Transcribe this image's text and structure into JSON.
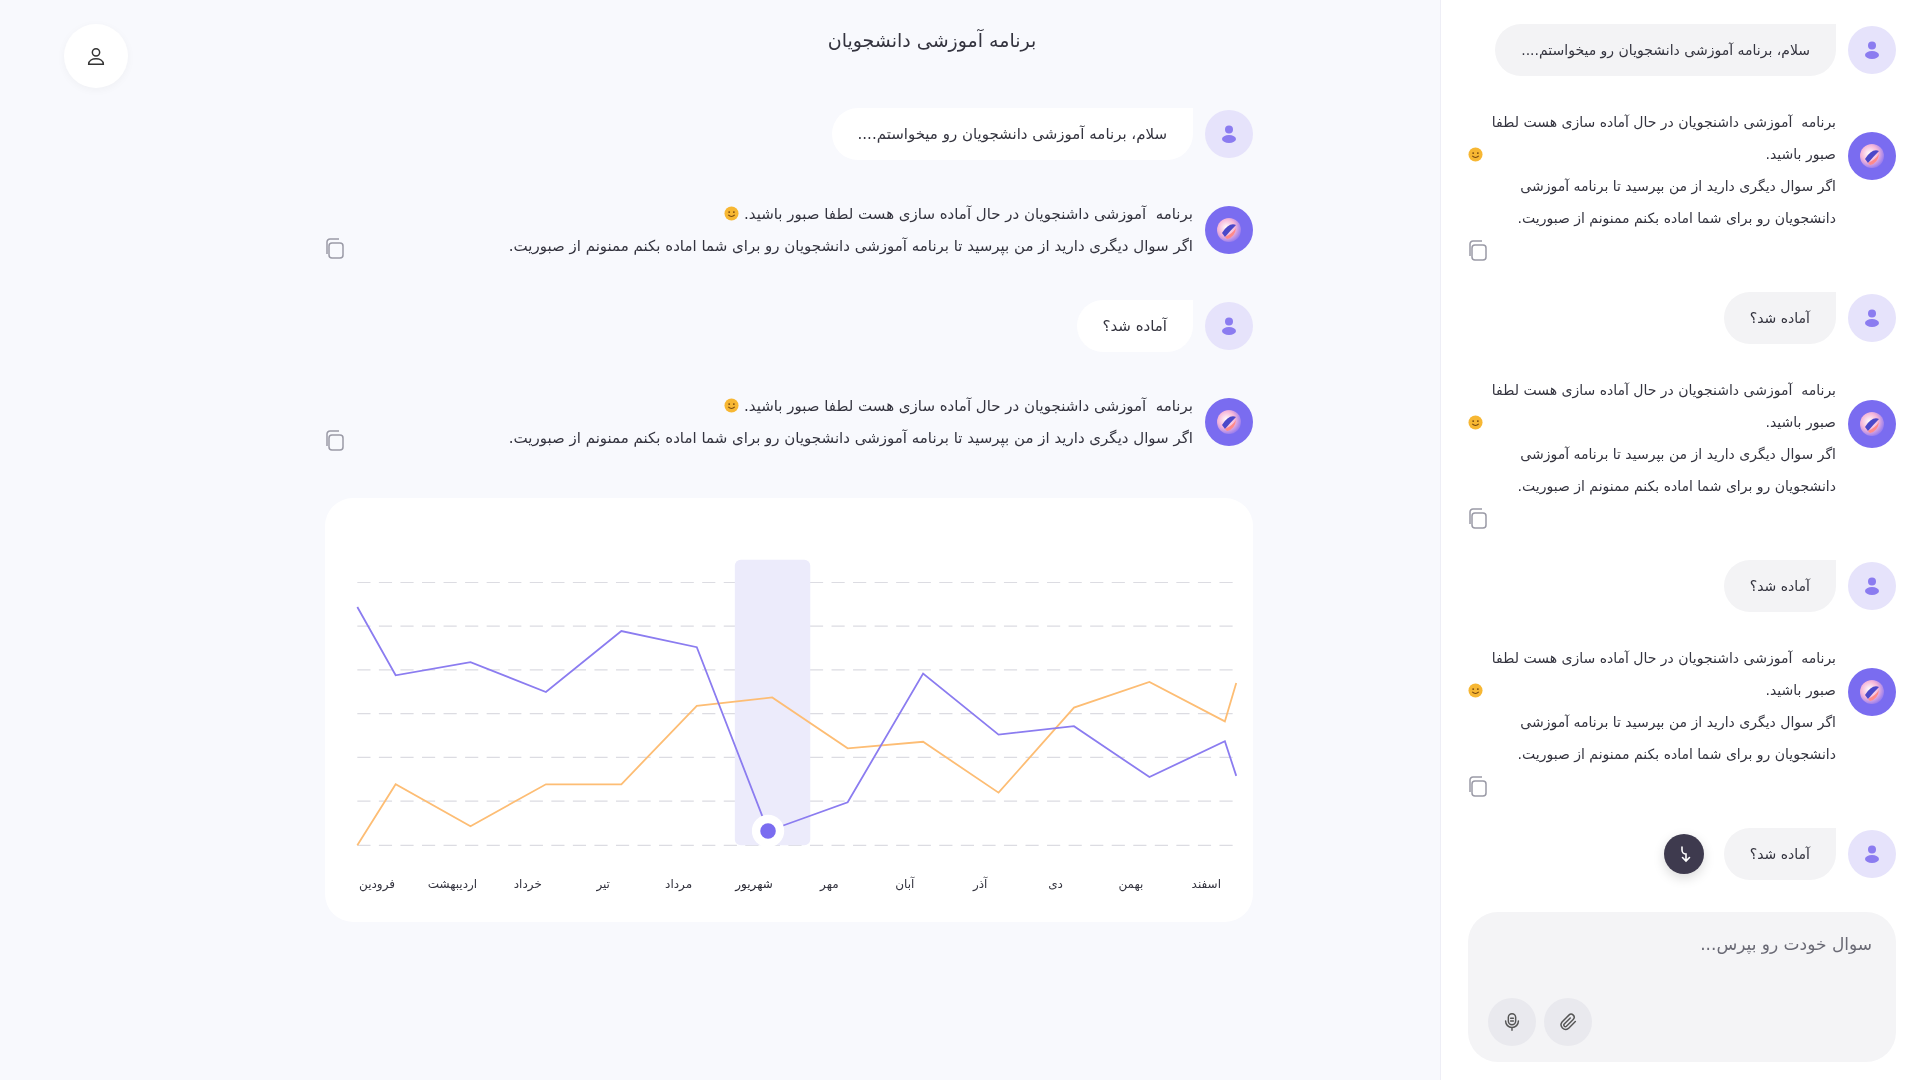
{
  "header": {
    "title": "برنامه آموزشی دانشجویان"
  },
  "main_chat": {
    "messages": [
      {
        "kind": "user",
        "text": "سلام، برنامه آموزشی دانشجویان رو میخواستم...."
      },
      {
        "kind": "bot",
        "lines": [
          "برنامه  آموزشی داشنجویان در حال آماده سازی هست لطفا صبور باشید.",
          "اگر سوال دیگری دارید از من بپرسید تا برنامه آموزشی دانشجویان رو برای شما اماده بکنم ممنونم از صبوریت."
        ]
      },
      {
        "kind": "user",
        "text": "آماده شد؟"
      },
      {
        "kind": "bot",
        "lines": [
          "برنامه  آموزشی داشنجویان در حال آماده سازی هست لطفا صبور باشید.",
          "اگر سوال دیگری دارید از من بپرسید تا برنامه آموزشی دانشجویان رو برای شما اماده بکنم ممنونم از صبوریت."
        ]
      }
    ]
  },
  "chart": {
    "months": [
      {
        "label": "اسفند",
        "selected": false
      },
      {
        "label": "بهمن",
        "selected": false
      },
      {
        "label": "دی",
        "selected": false
      },
      {
        "label": "آذر",
        "selected": false
      },
      {
        "label": "آبان",
        "selected": false
      },
      {
        "label": "مهر",
        "selected": false
      },
      {
        "label": "شهریور",
        "selected": true
      },
      {
        "label": "مرداد",
        "selected": false
      },
      {
        "label": "تیر",
        "selected": false
      },
      {
        "label": "خرداد",
        "selected": false
      },
      {
        "label": "اردیبهشت",
        "selected": false
      },
      {
        "label": "فرودین",
        "selected": false
      }
    ]
  },
  "side_chat": {
    "messages": [
      {
        "kind": "user",
        "text": "سلام، برنامه آموزشی دانشجویان رو میخواستم...."
      },
      {
        "kind": "bot",
        "lines": [
          "برنامه  آموزشی داشنجویان در حال آماده سازی هست لطفا صبور باشید.",
          "اگر سوال دیگری دارید از من بپرسید تا برنامه آموزشی دانشجویان رو برای شما اماده بکنم ممنونم از صبوریت."
        ]
      },
      {
        "kind": "user",
        "text": "آماده شد؟"
      },
      {
        "kind": "bot",
        "lines": [
          "برنامه  آموزشی داشنجویان در حال آماده سازی هست لطفا صبور باشید.",
          "اگر سوال دیگری دارید از من بپرسید تا برنامه آموزشی دانشجویان رو برای شما اماده بکنم ممنونم از صبوریت."
        ]
      },
      {
        "kind": "user",
        "text": "آماده شد؟"
      },
      {
        "kind": "bot",
        "lines": [
          "برنامه  آموزشی داشنجویان در حال آماده سازی هست لطفا صبور باشید.",
          "اگر سوال دیگری دارید از من بپرسید تا برنامه آموزشی دانشجویان رو برای شما اماده بکنم ممنونم از صبوریت."
        ]
      },
      {
        "kind": "user",
        "text": "آماده شد؟"
      }
    ]
  },
  "composer": {
    "placeholder": "سوال خودت رو بپرس..."
  }
}
